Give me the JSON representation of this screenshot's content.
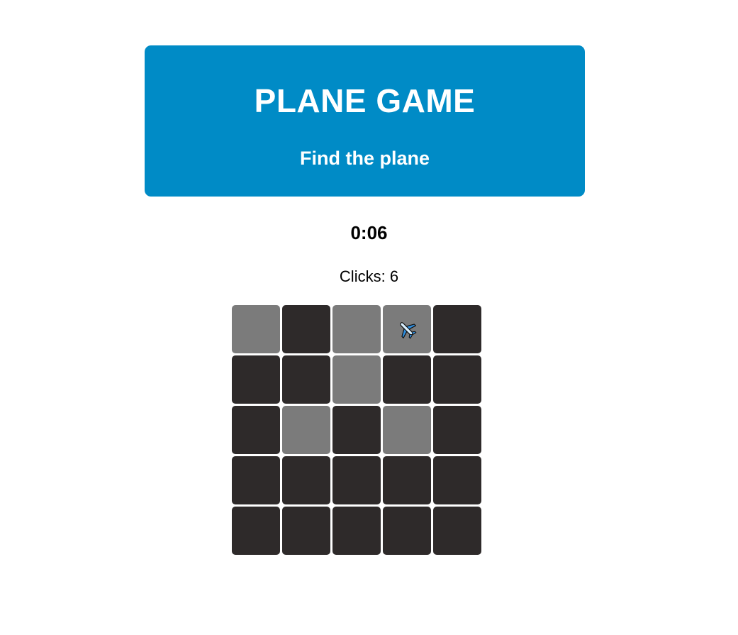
{
  "header": {
    "title": "PLANE GAME",
    "subtitle": "Find the plane"
  },
  "status": {
    "timer": "0:06",
    "clicks_label": "Clicks: ",
    "clicks_value": "6"
  },
  "colors": {
    "header_bg": "#008bc6",
    "cell_hidden": "#2e2a2a",
    "cell_revealed": "#7b7b7b"
  },
  "board": {
    "rows": 5,
    "cols": 5,
    "cells": [
      [
        "revealed",
        "hidden",
        "revealed",
        "plane",
        "hidden"
      ],
      [
        "hidden",
        "hidden",
        "revealed",
        "hidden",
        "hidden"
      ],
      [
        "hidden",
        "revealed",
        "hidden",
        "revealed",
        "hidden"
      ],
      [
        "hidden",
        "hidden",
        "hidden",
        "hidden",
        "hidden"
      ],
      [
        "hidden",
        "hidden",
        "hidden",
        "hidden",
        "hidden"
      ]
    ],
    "plane_icon": "airplane-icon"
  }
}
